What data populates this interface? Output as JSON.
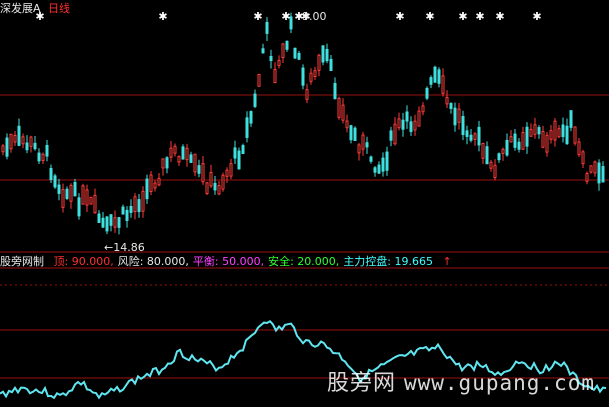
{
  "header": {
    "stock_name": "深发展A",
    "period": "日线"
  },
  "price_panel": {
    "high_label": "9.00",
    "low_label": "←14.86",
    "signal_glyph": "✱"
  },
  "indicator": {
    "name": "股旁网制",
    "items": [
      {
        "label": "顶",
        "value": "90.000,",
        "color": "#ff3030"
      },
      {
        "label": "风险",
        "value": "80.000,",
        "color": "#e8e8e8"
      },
      {
        "label": "平衡",
        "value": "50.000,",
        "color": "#ff40ff"
      },
      {
        "label": "安全",
        "value": "20.000,",
        "color": "#30ff30"
      },
      {
        "label": "主力控盘",
        "value": "19.665",
        "color": "#40ffff"
      }
    ],
    "arrow": "↑"
  },
  "watermark": {
    "text": "股旁网",
    "domain": "www.gupang.com"
  },
  "colors": {
    "up": "#ff3b3b",
    "down": "#40e0e0",
    "grid": "#9a1010",
    "line": "#5fe6f0"
  }
}
